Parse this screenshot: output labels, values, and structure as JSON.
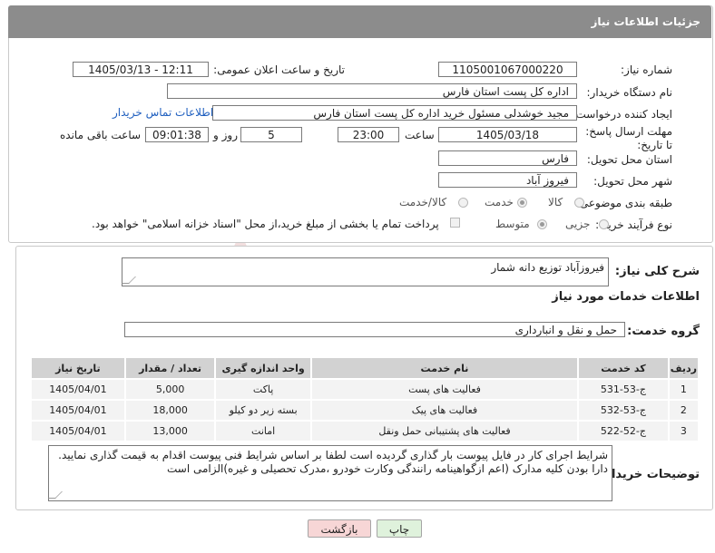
{
  "header": {
    "title": "جزئیات اطلاعات نیاز"
  },
  "form": {
    "need_number_label": "شماره نیاز:",
    "need_number": "1105001067000220",
    "announce_label": "تاریخ و ساعت اعلان عمومی:",
    "announce_value": "1405/03/13 - 12:11",
    "buyer_org_label": "نام دستگاه خریدار:",
    "buyer_org": "اداره کل پست استان فارس",
    "creator_label": "ایجاد کننده درخواست:",
    "creator": "مجید خوشدلی مسئول خرید اداره کل پست استان فارس",
    "contact_link": "اطلاعات تماس خریدار",
    "deadline_label": "مهلت ارسال پاسخ: تا تاریخ:",
    "deadline_date": "1405/03/18",
    "time_label": "ساعت",
    "deadline_time": "23:00",
    "days_value": "5",
    "days_label": "روز و",
    "remaining_time": "09:01:38",
    "remaining_label": "ساعت باقی مانده",
    "province_label": "استان محل تحویل:",
    "province": "فارس",
    "city_label": "شهر محل تحویل:",
    "city": "فیروز آباد",
    "category_label": "طبقه بندی موضوعی:",
    "category_options": [
      "کالا",
      "خدمت",
      "کالا/خدمت"
    ],
    "process_label": "نوع فرآیند خرید :",
    "process_options": [
      "جزیی",
      "متوسط"
    ],
    "payment_note": "پرداخت تمام یا بخشی از مبلغ خرید،از محل \"اسناد خزانه اسلامی\" خواهد بود."
  },
  "summary": {
    "label": "شرح کلی نیاز:",
    "value": "فیروزآباد توزیع دانه شمار"
  },
  "services": {
    "section_title": "اطلاعات خدمات مورد نیاز",
    "group_label": "گروه خدمت:",
    "group_value": "حمل و نقل و انبارداری",
    "columns": [
      "ردیف",
      "کد خدمت",
      "نام خدمت",
      "واحد اندازه گیری",
      "تعداد / مقدار",
      "تاریخ نیاز"
    ],
    "rows": [
      [
        "1",
        "ج-53-531",
        "فعالیت های پست",
        "پاکت",
        "5,000",
        "1405/04/01"
      ],
      [
        "2",
        "ج-53-532",
        "فعالیت های پیک",
        "بسته زیر دو کیلو",
        "18,000",
        "1405/04/01"
      ],
      [
        "3",
        "ج-52-522",
        "فعالیت های پشتیبانی حمل ونقل",
        "امانت",
        "13,000",
        "1405/04/01"
      ]
    ]
  },
  "buyer_notes": {
    "label": "توضیحات خریدار:",
    "value": "شرایط اجرای کار در فایل پیوست بار گذاری گردیده است لطفا بر اساس شرایط فنی پیوست اقدام به قیمت گذاری نمایید. دارا بودن کلیه مدارک (اعم ازگواهینامه رانندگی وکارت خودرو ،مدرک تحصیلی و غیره)الزامی است"
  },
  "buttons": {
    "print": "چاپ",
    "back": "بازگشت"
  },
  "colors": {
    "header_bg": "#8c8c8c",
    "link": "#1f5fbf",
    "back_btn": "#f7d6d6",
    "print_btn": "#dff2dc"
  }
}
